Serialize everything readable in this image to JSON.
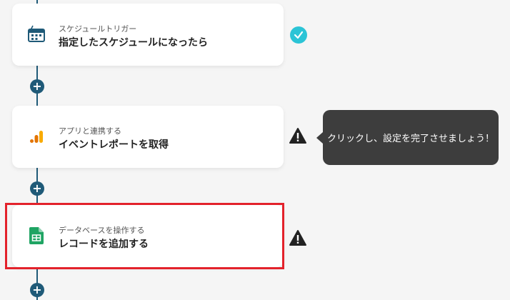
{
  "flow": {
    "steps": [
      {
        "sub": "スケジュールトリガー",
        "title": "指定したスケジュールになったら",
        "icon": "schedule-trigger-icon",
        "status": "complete"
      },
      {
        "sub": "アプリと連携する",
        "title": "イベントレポートを取得",
        "icon": "google-analytics-icon",
        "status": "warning"
      },
      {
        "sub": "データベースを操作する",
        "title": "レコードを追加する",
        "icon": "google-sheets-icon",
        "status": "warning",
        "highlighted": true
      }
    ],
    "add_symbol": "+"
  },
  "tooltip": {
    "text": "クリックし、設定を完了させましょう！"
  },
  "colors": {
    "connector": "#1f5a78",
    "check": "#2bc4d6",
    "highlight": "#e3222b",
    "tooltip_bg": "#3d3d3d",
    "sheets_green": "#1fa463",
    "analytics_orange": "#f9ab00"
  }
}
